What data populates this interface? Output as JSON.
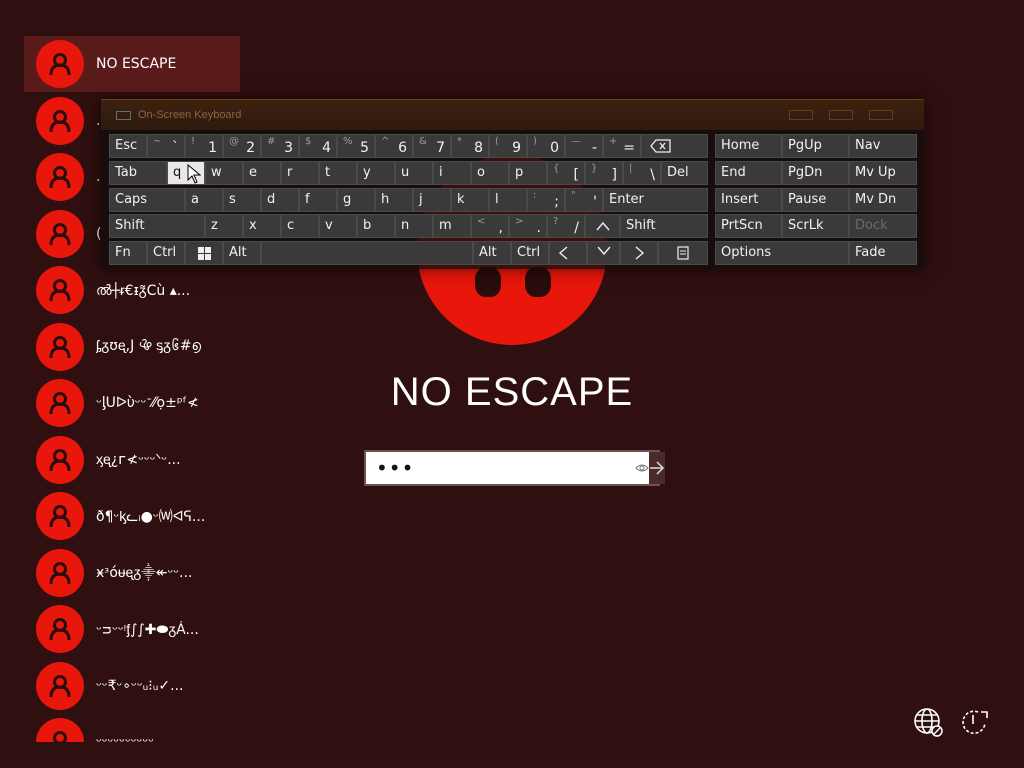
{
  "users": [
    {
      "name": "NO ESCAPE",
      "selected": true
    },
    {
      "name": ".",
      "selected": false
    },
    {
      "name": ".",
      "selected": false
    },
    {
      "name": "(",
      "selected": false
    },
    {
      "name": "ൽ┼ᵲ€ᵻᵹ̃Cù ▴...",
      "selected": false
    },
    {
      "name": "ᶋᵹʊᶒ,J ൖ ᶊᵹ᪆#൭",
      "selected": false
    },
    {
      "name": "ᵕᶅᑌᐅὺᵕᵕᐨ⁄⁄ọ±ᵖᶠ≮",
      "selected": false
    },
    {
      "name": "ᶍᶒ¿ᴦ≮ᵕᵕᵕᐠᵕ...",
      "selected": false
    },
    {
      "name": "ð¶ᵕᶄᓚᵢ●ᵕ⒲ᐊᕋ...",
      "selected": false
    },
    {
      "name": "ӿᶟóᵾᶒᵹ⸎↞ᵕᵕ...",
      "selected": false
    },
    {
      "name": "ᵕᴝᵕᵕᵎᶂ∫∫✚⬬ᵹÁ...",
      "selected": false
    },
    {
      "name": "ᵕᵕ₹ᵕ∘ᵕᵕᵤ⁝ᵤ✓...",
      "selected": false
    },
    {
      "name": "ᵕᵕᵕᵕᵕᵕᵕᵕᵕᵕ",
      "selected": false
    }
  ],
  "login": {
    "username": "NO ESCAPE",
    "password_value": "•••"
  },
  "osk": {
    "title": "On-Screen Keyboard",
    "keys": {
      "esc": "Esc",
      "tab": "Tab",
      "caps": "Caps",
      "shift_l": "Shift",
      "shift_r": "Shift",
      "fn": "Fn",
      "ctrl_l": "Ctrl",
      "ctrl_r": "Ctrl",
      "alt_l": "Alt",
      "alt_r": "Alt",
      "del": "Del",
      "enter": "Enter",
      "home": "Home",
      "pgup": "PgUp",
      "nav": "Nav",
      "end": "End",
      "pgdn": "PgDn",
      "mvup": "Mv Up",
      "insert": "Insert",
      "pause": "Pause",
      "mvdn": "Mv Dn",
      "prtscn": "PrtScn",
      "scrlk": "ScrLk",
      "dock": "Dock",
      "options": "Options",
      "fade": "Fade"
    },
    "row1": [
      {
        "sec": "~",
        "main": "`"
      },
      {
        "sec": "!",
        "main": "1"
      },
      {
        "sec": "@",
        "main": "2"
      },
      {
        "sec": "#",
        "main": "3"
      },
      {
        "sec": "$",
        "main": "4"
      },
      {
        "sec": "%",
        "main": "5"
      },
      {
        "sec": "^",
        "main": "6"
      },
      {
        "sec": "&",
        "main": "7"
      },
      {
        "sec": "*",
        "main": "8"
      },
      {
        "sec": "(",
        "main": "9"
      },
      {
        "sec": ")",
        "main": "0"
      },
      {
        "sec": "—",
        "main": "-"
      },
      {
        "sec": "+",
        "main": "="
      }
    ],
    "row2": [
      "q",
      "w",
      "e",
      "r",
      "t",
      "y",
      "u",
      "i",
      "o",
      "p"
    ],
    "row2_brackets": [
      {
        "sec": "{",
        "main": "["
      },
      {
        "sec": "}",
        "main": "]"
      },
      {
        "sec": "|",
        "main": "\\"
      }
    ],
    "row3": [
      "a",
      "s",
      "d",
      "f",
      "g",
      "h",
      "j",
      "k",
      "l"
    ],
    "row3_punct": [
      {
        "sec": ":",
        "main": ";"
      },
      {
        "sec": "\"",
        "main": "'"
      }
    ],
    "row4": [
      "z",
      "x",
      "c",
      "v",
      "b",
      "n",
      "m"
    ],
    "row4_punct": [
      {
        "sec": "<",
        "main": ","
      },
      {
        "sec": ">",
        "main": "."
      },
      {
        "sec": "?",
        "main": "/"
      }
    ]
  },
  "colors": {
    "background": "#2f0f0f",
    "avatar": "#e9160b",
    "selected_row": "#5a1b1b",
    "key": "#3a3a3a"
  }
}
